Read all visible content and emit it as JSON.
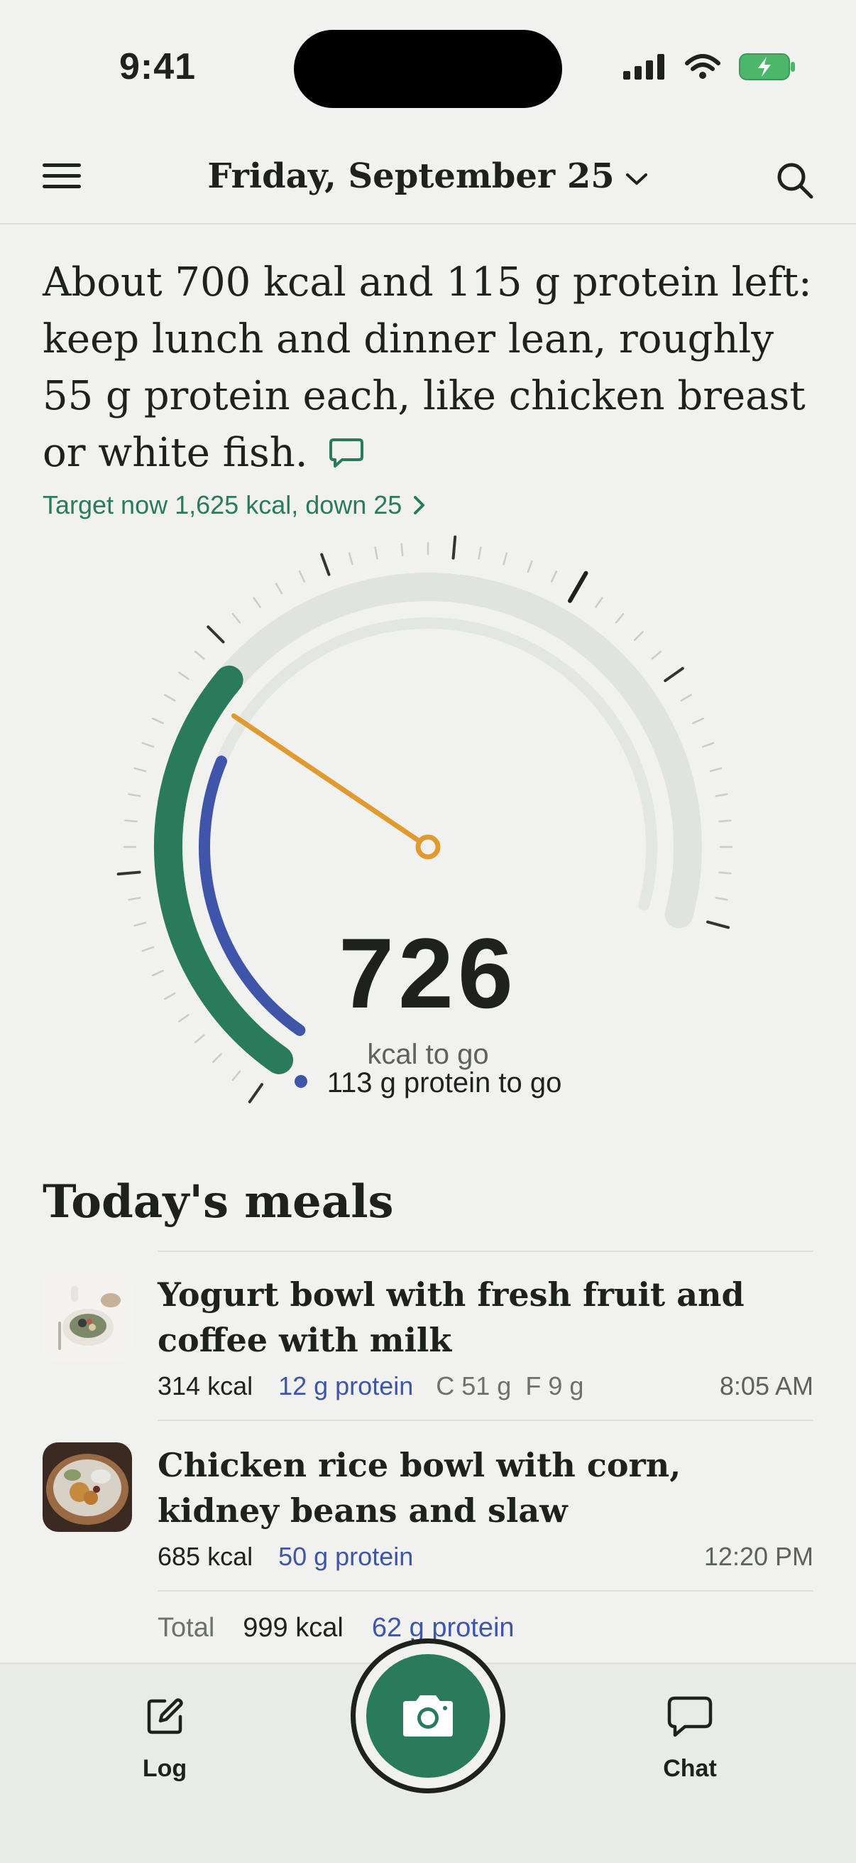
{
  "status_bar": {
    "time": "9:41"
  },
  "header": {
    "date": "Friday, September 25"
  },
  "advice": {
    "text": "About 700 kcal and 115 g protein left: keep lunch and dinner lean, roughly 55 g protein each, like chicken breast or white fish.",
    "target_link": "Target now 1,625 kcal, down 25"
  },
  "gauge": {
    "kcal_left": "726",
    "kcal_label": "kcal to go",
    "protein_label": "113 g protein to go",
    "kcal_fraction_eaten": 0.38,
    "protein_fraction_eaten": 0.31
  },
  "meals": {
    "title": "Today's meals",
    "items": [
      {
        "name": "Yogurt bowl with fresh fruit and coffee with milk",
        "kcal": "314 kcal",
        "protein": "12 g protein",
        "carbs": "C 51 g",
        "fat": "F 9 g",
        "time": "8:05 AM"
      },
      {
        "name": "Chicken rice bowl with corn, kidney beans and slaw",
        "kcal": "685 kcal",
        "protein": "50 g protein",
        "time": "12:20 PM"
      }
    ],
    "total": {
      "label": "Total",
      "kcal": "999 kcal",
      "protein": "62 g protein"
    }
  },
  "tabbar": {
    "log": "Log",
    "chat": "Chat"
  },
  "colors": {
    "accent_green": "#2a7b5c",
    "protein_blue": "#3f55aa",
    "needle_orange": "#e09a30",
    "background": "#f1f2ef"
  }
}
